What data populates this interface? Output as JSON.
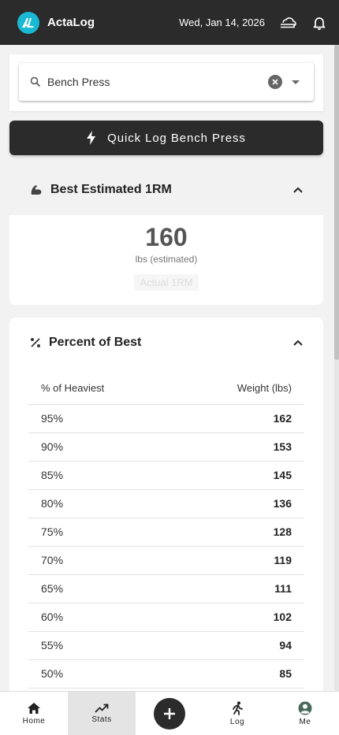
{
  "header": {
    "app_title": "ActaLog",
    "date": "Wed, Jan 14, 2026",
    "logo_text": "AL",
    "icons": [
      "logo-icon",
      "cloud-sync-icon",
      "bell-icon"
    ]
  },
  "search": {
    "value": "Bench Press"
  },
  "quick_log": {
    "label": "Quick Log Bench Press"
  },
  "best_1rm": {
    "title": "Best Estimated 1RM",
    "value": "160",
    "unit": "lbs (estimated)",
    "actual_label": "Actual 1RM"
  },
  "percent": {
    "title": "Percent of Best",
    "headers": [
      "% of Heaviest",
      "Weight (lbs)"
    ],
    "rows": [
      {
        "pct": "95%",
        "weight": "162"
      },
      {
        "pct": "90%",
        "weight": "153"
      },
      {
        "pct": "85%",
        "weight": "145"
      },
      {
        "pct": "80%",
        "weight": "136"
      },
      {
        "pct": "75%",
        "weight": "128"
      },
      {
        "pct": "70%",
        "weight": "119"
      },
      {
        "pct": "65%",
        "weight": "111"
      },
      {
        "pct": "60%",
        "weight": "102"
      },
      {
        "pct": "55%",
        "weight": "94"
      },
      {
        "pct": "50%",
        "weight": "85"
      }
    ]
  },
  "nav": {
    "home": "Home",
    "stats": "Stats",
    "log": "Log",
    "me": "Me",
    "active": "stats"
  },
  "colors": {
    "appbar": "#2b2b2b",
    "accent": "#19b9d4",
    "profile": "#4a6b5a"
  }
}
